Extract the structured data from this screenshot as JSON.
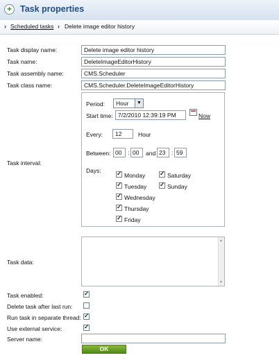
{
  "header": {
    "title": "Task properties",
    "icon": "add-icon"
  },
  "breadcrumb": {
    "parent": "Scheduled tasks",
    "current": "Delete image editor history"
  },
  "fields": {
    "display_name": {
      "label": "Task display name:",
      "value": "Delete image editor history"
    },
    "name": {
      "label": "Task name:",
      "value": "DeleteImageEditorHistory"
    },
    "assembly": {
      "label": "Task assembly name:",
      "value": "CMS.Scheduler"
    },
    "class": {
      "label": "Task class name:",
      "value": "CMS.Scheduler.DeleteImageEditorHistory"
    }
  },
  "interval": {
    "label": "Task interval:",
    "period_label": "Period:",
    "period_value": "Hour",
    "start_label": "Start time:",
    "start_value": "7/2/2010 12:39:19 PM",
    "now_label": "Now",
    "every_label": "Every:",
    "every_value": "12",
    "every_unit": "Hour",
    "between_label": "Between:",
    "from_h": "00",
    "from_m": "00",
    "and_label": "and",
    "to_h": "23",
    "to_m": "59",
    "colon": ":",
    "days_label": "Days:",
    "days": [
      {
        "name": "Monday",
        "checked": true
      },
      {
        "name": "Tuesday",
        "checked": true
      },
      {
        "name": "Wednesday",
        "checked": true
      },
      {
        "name": "Thursday",
        "checked": true
      },
      {
        "name": "Friday",
        "checked": true
      },
      {
        "name": "Saturday",
        "checked": true
      },
      {
        "name": "Sunday",
        "checked": true
      }
    ]
  },
  "task_data": {
    "label": "Task data:",
    "value": ""
  },
  "options": {
    "enabled": {
      "label": "Task enabled:",
      "checked": true
    },
    "delete_after": {
      "label": "Delete task after last run:",
      "checked": false
    },
    "separate_thread": {
      "label": "Run task in separate thread:",
      "checked": true
    },
    "external_service": {
      "label": "Use external service:",
      "checked": true
    }
  },
  "server": {
    "label": "Server name:",
    "value": ""
  },
  "ok_label": "OK"
}
